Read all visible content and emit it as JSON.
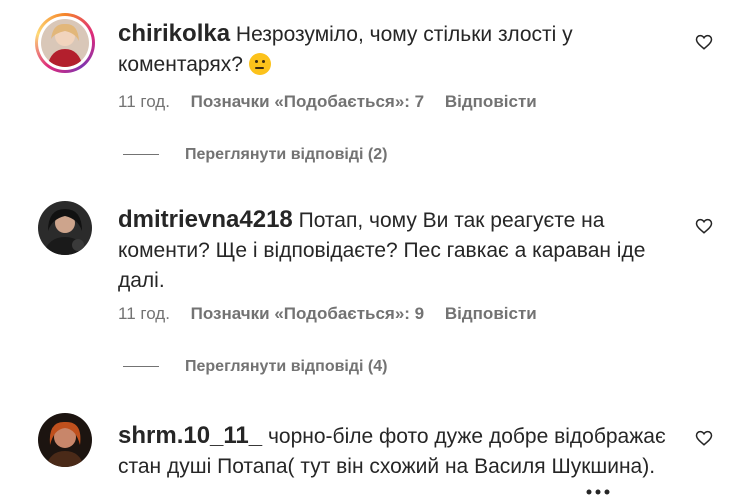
{
  "comments": [
    {
      "username": "chirikolka",
      "text": "Незрозуміло, чому стільки злості у коментарях?",
      "emoji": "thinking-face",
      "time": "11 год.",
      "likes": "Позначки «Подобається»: 7",
      "reply": "Відповісти",
      "view_replies": "Переглянути відповіді (2)"
    },
    {
      "username": "dmitrievna4218",
      "text": "Потап, чому Ви так реагуєте на коменти? Ще і відповідаєте? Пес гавкає а караван іде далі.",
      "time": "11 год.",
      "likes": "Позначки «Подобається»: 9",
      "reply": "Відповісти",
      "view_replies": "Переглянути відповіді (4)"
    },
    {
      "username": "shrm.10_11_",
      "text": "чорно-біле фото дуже добре відображає стан душі Потапа( тут він схожий на Василя Шукшина)."
    }
  ],
  "colors": {
    "text": "#262626",
    "secondary": "#737373"
  }
}
